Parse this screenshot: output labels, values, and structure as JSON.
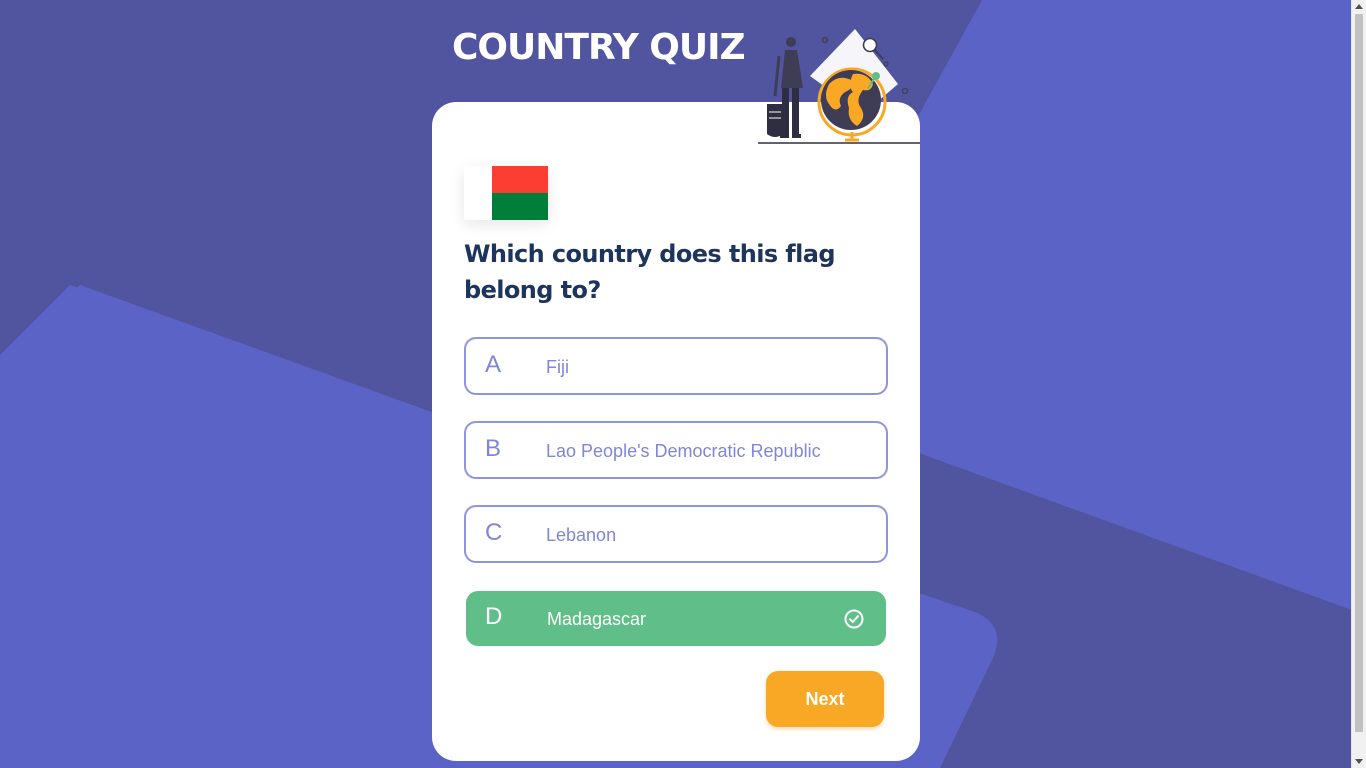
{
  "app": {
    "title": "COUNTRY QUIZ"
  },
  "question": {
    "text": "Which country does this flag belong to?",
    "flag_country": "Madagascar",
    "flag_colors": {
      "white": "#ffffff",
      "red": "#fc3d32",
      "green": "#007e3a"
    }
  },
  "options": [
    {
      "letter": "A",
      "label": "Fiji",
      "state": "default"
    },
    {
      "letter": "B",
      "label": "Lao People's Democratic Republic",
      "state": "default"
    },
    {
      "letter": "C",
      "label": "Lebanon",
      "state": "default"
    },
    {
      "letter": "D",
      "label": "Madagascar",
      "state": "correct",
      "icon": "check-circle-icon"
    }
  ],
  "actions": {
    "next_label": "Next"
  },
  "colors": {
    "background": "#5c63c6",
    "option_border": "#6066d0",
    "correct": "#60bf88",
    "accent": "#f9a826",
    "question_text": "#1d355d"
  }
}
